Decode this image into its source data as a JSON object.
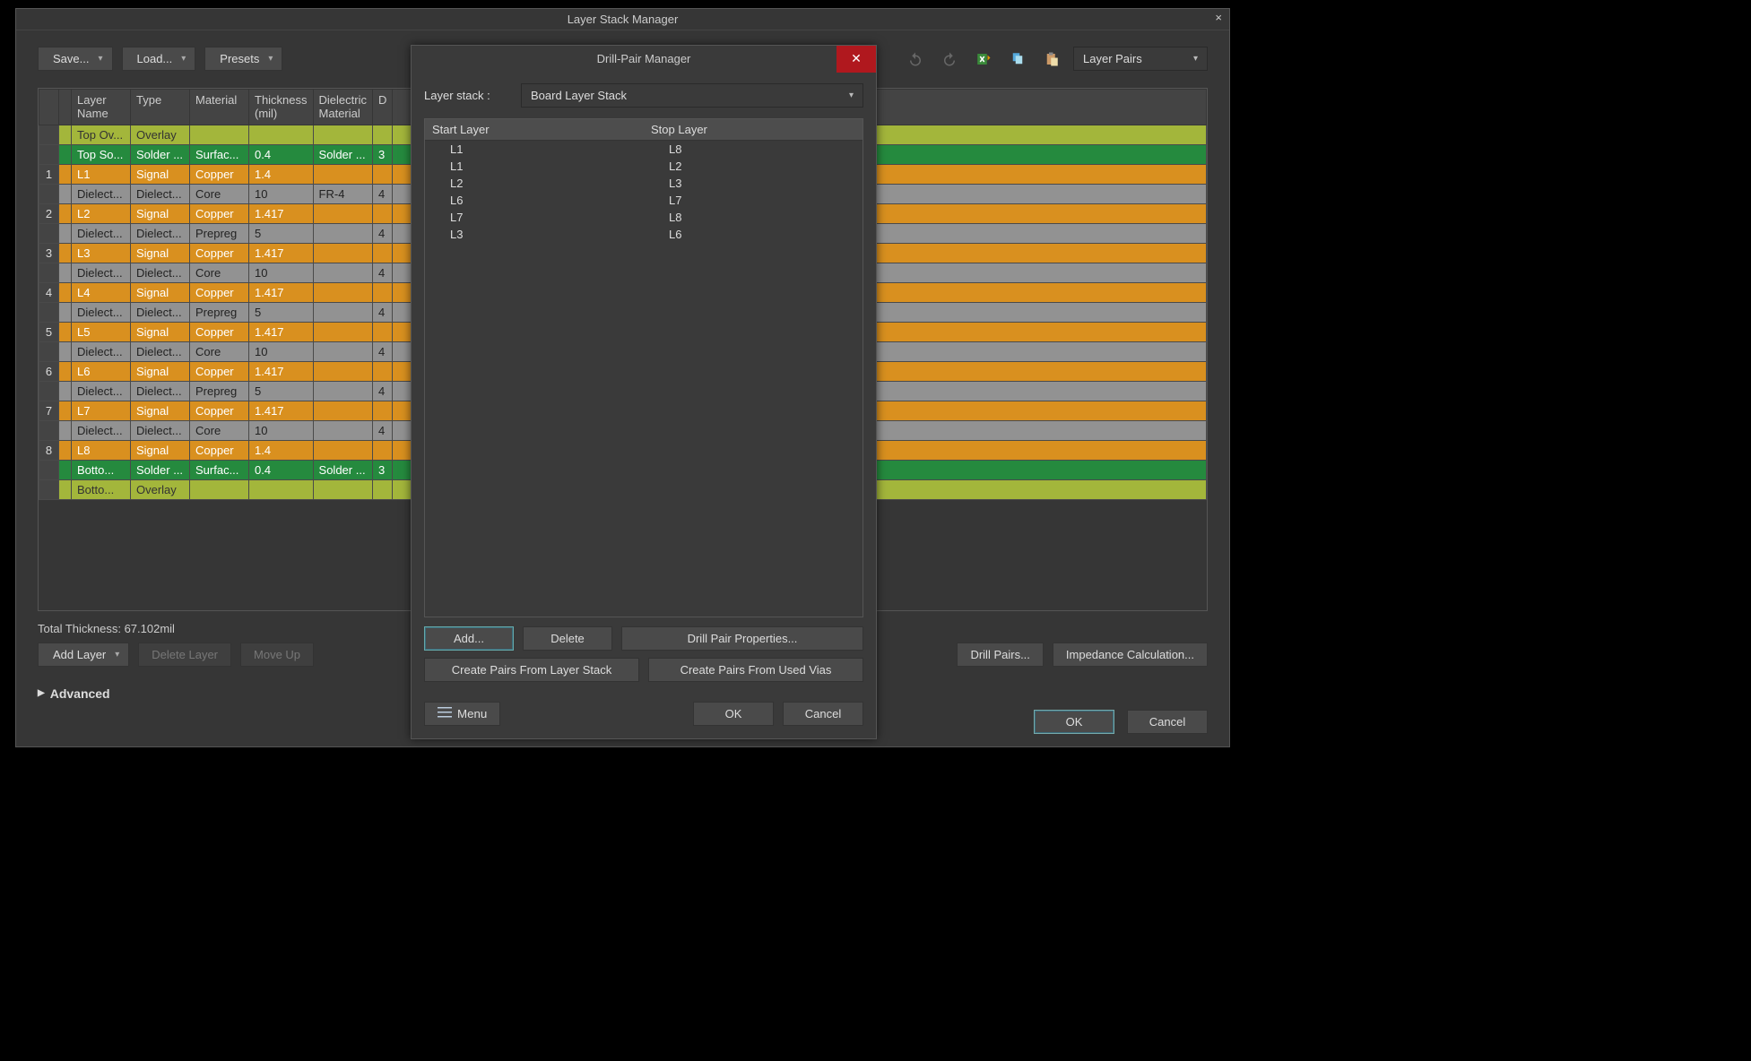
{
  "window": {
    "title": "Layer Stack Manager"
  },
  "toolbar": {
    "save": "Save...",
    "load": "Load...",
    "presets": "Presets",
    "layer_pairs_dropdown": "Layer Pairs"
  },
  "columns": {
    "layer_name": "Layer Name",
    "type": "Type",
    "material": "Material",
    "thickness": "Thickness (mil)",
    "dielectric_material": "Dielectric Material",
    "d": "D"
  },
  "rows": [
    {
      "idx": "",
      "cls": "overlay",
      "name": "Top Ov...",
      "type": "Overlay",
      "material": "",
      "thick": "",
      "diel": "",
      "d": ""
    },
    {
      "idx": "",
      "cls": "solder",
      "name": "Top So...",
      "type": "Solder ...",
      "material": "Surfac...",
      "thick": "0.4",
      "diel": "Solder ...",
      "d": "3"
    },
    {
      "idx": "1",
      "cls": "signal",
      "name": "L1",
      "type": "Signal",
      "material": "Copper",
      "thick": "1.4",
      "diel": "",
      "d": ""
    },
    {
      "idx": "",
      "cls": "dielect",
      "name": "Dielect...",
      "type": "Dielect...",
      "material": "Core",
      "thick": "10",
      "diel": "FR-4",
      "d": "4"
    },
    {
      "idx": "2",
      "cls": "signal",
      "name": "L2",
      "type": "Signal",
      "material": "Copper",
      "thick": "1.417",
      "diel": "",
      "d": ""
    },
    {
      "idx": "",
      "cls": "dielect",
      "name": "Dielect...",
      "type": "Dielect...",
      "material": "Prepreg",
      "thick": "5",
      "diel": "",
      "d": "4"
    },
    {
      "idx": "3",
      "cls": "signal",
      "name": "L3",
      "type": "Signal",
      "material": "Copper",
      "thick": "1.417",
      "diel": "",
      "d": ""
    },
    {
      "idx": "",
      "cls": "dielect",
      "name": "Dielect...",
      "type": "Dielect...",
      "material": "Core",
      "thick": "10",
      "diel": "",
      "d": "4"
    },
    {
      "idx": "4",
      "cls": "signal",
      "name": "L4",
      "type": "Signal",
      "material": "Copper",
      "thick": "1.417",
      "diel": "",
      "d": ""
    },
    {
      "idx": "",
      "cls": "dielect",
      "name": "Dielect...",
      "type": "Dielect...",
      "material": "Prepreg",
      "thick": "5",
      "diel": "",
      "d": "4"
    },
    {
      "idx": "5",
      "cls": "signal",
      "name": "L5",
      "type": "Signal",
      "material": "Copper",
      "thick": "1.417",
      "diel": "",
      "d": ""
    },
    {
      "idx": "",
      "cls": "dielect",
      "name": "Dielect...",
      "type": "Dielect...",
      "material": "Core",
      "thick": "10",
      "diel": "",
      "d": "4"
    },
    {
      "idx": "6",
      "cls": "signal",
      "name": "L6",
      "type": "Signal",
      "material": "Copper",
      "thick": "1.417",
      "diel": "",
      "d": ""
    },
    {
      "idx": "",
      "cls": "dielect",
      "name": "Dielect...",
      "type": "Dielect...",
      "material": "Prepreg",
      "thick": "5",
      "diel": "",
      "d": "4"
    },
    {
      "idx": "7",
      "cls": "signal",
      "name": "L7",
      "type": "Signal",
      "material": "Copper",
      "thick": "1.417",
      "diel": "",
      "d": ""
    },
    {
      "idx": "",
      "cls": "dielect",
      "name": "Dielect...",
      "type": "Dielect...",
      "material": "Core",
      "thick": "10",
      "diel": "",
      "d": "4"
    },
    {
      "idx": "8",
      "cls": "signal",
      "name": "L8",
      "type": "Signal",
      "material": "Copper",
      "thick": "1.4",
      "diel": "",
      "d": ""
    },
    {
      "idx": "",
      "cls": "solder",
      "name": "Botto...",
      "type": "Solder ...",
      "material": "Surfac...",
      "thick": "0.4",
      "diel": "Solder ...",
      "d": "3"
    },
    {
      "idx": "",
      "cls": "overlay",
      "name": "Botto...",
      "type": "Overlay",
      "material": "",
      "thick": "",
      "diel": "",
      "d": ""
    }
  ],
  "total_thickness": "Total Thickness: 67.102mil",
  "bottom": {
    "add_layer": "Add Layer",
    "delete_layer": "Delete Layer",
    "move_up": "Move Up",
    "drill_pairs": "Drill Pairs...",
    "impedance_calc": "Impedance Calculation..."
  },
  "advanced": "Advanced",
  "footer": {
    "ok": "OK",
    "cancel": "Cancel"
  },
  "modal": {
    "title": "Drill-Pair Manager",
    "layer_stack_label": "Layer stack :",
    "layer_stack_value": "Board Layer Stack",
    "col_start": "Start Layer",
    "col_stop": "Stop Layer",
    "pairs": [
      {
        "start": "L1",
        "stop": "L8"
      },
      {
        "start": "L1",
        "stop": "L2"
      },
      {
        "start": "L2",
        "stop": "L3"
      },
      {
        "start": "L6",
        "stop": "L7"
      },
      {
        "start": "L7",
        "stop": "L8"
      },
      {
        "start": "L3",
        "stop": "L6"
      }
    ],
    "add": "Add...",
    "delete": "Delete",
    "drill_props": "Drill Pair Properties...",
    "create_from_stack": "Create Pairs From Layer Stack",
    "create_from_vias": "Create Pairs From Used Vias",
    "menu": "Menu",
    "ok": "OK",
    "cancel": "Cancel"
  }
}
